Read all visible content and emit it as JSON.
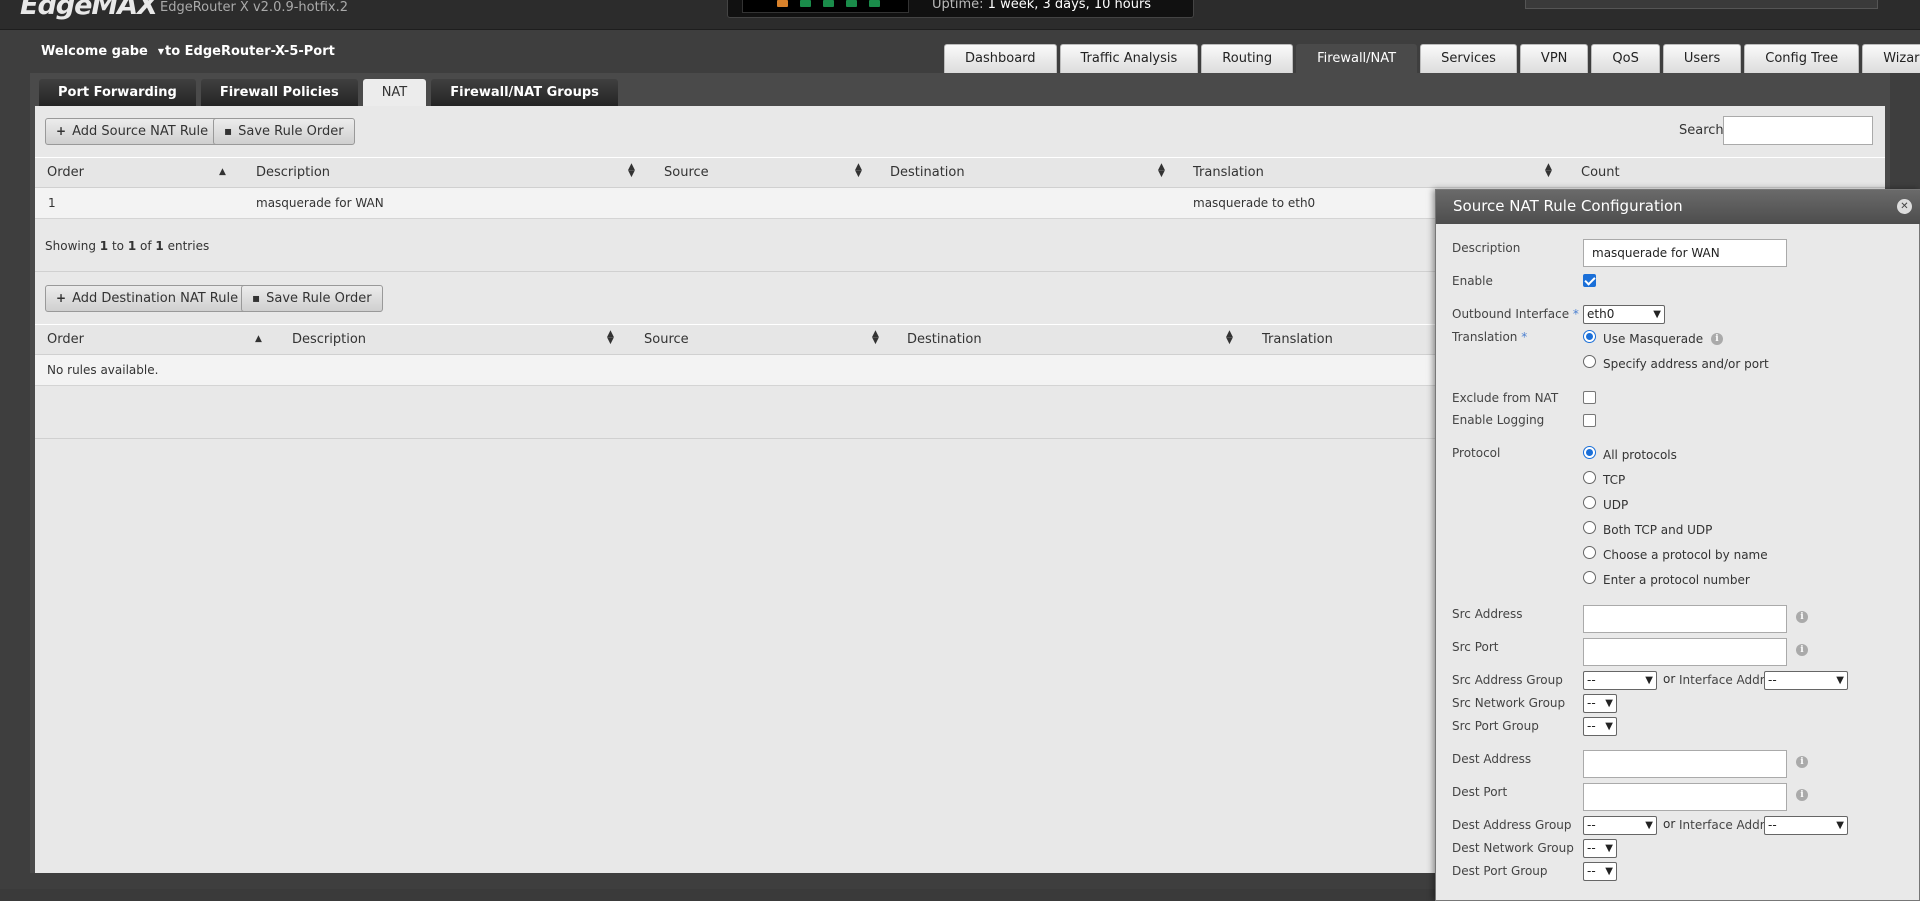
{
  "header": {
    "logo": "EdgeMAX",
    "version": "EdgeRouter X v2.0.9-hotfix.2",
    "uptime_label": "Uptime:",
    "uptime_value": "1 week, 3 days, 10 hours"
  },
  "user": {
    "welcome": "Welcome gabe",
    "device": "to EdgeRouter-X-5-Port"
  },
  "main_nav": {
    "items": [
      "Dashboard",
      "Traffic Analysis",
      "Routing",
      "Firewall/NAT",
      "Services",
      "VPN",
      "QoS",
      "Users",
      "Config Tree",
      "Wizards"
    ],
    "active": "Firewall/NAT"
  },
  "sub_tabs": {
    "items": [
      "Port Forwarding",
      "Firewall Policies",
      "NAT",
      "Firewall/NAT Groups"
    ],
    "active": "NAT"
  },
  "source_nat": {
    "add_button": "Add Source NAT Rule",
    "save_button": "Save Rule Order",
    "search_label": "Search",
    "columns": [
      "Order",
      "Description",
      "Source",
      "Destination",
      "Translation",
      "Count"
    ],
    "rows": [
      {
        "order": "1",
        "description": "masquerade for WAN",
        "source": "",
        "destination": "",
        "translation": "masquerade to eth0"
      }
    ],
    "showing_prefix": "Showing",
    "showing_from": "1",
    "showing_to_word": "to",
    "showing_to": "1",
    "showing_of_word": "of",
    "showing_total": "1",
    "showing_suffix": "entries"
  },
  "dest_nat": {
    "add_button": "Add Destination NAT Rule",
    "save_button": "Save Rule Order",
    "columns": [
      "Order",
      "Description",
      "Source",
      "Destination",
      "Translation"
    ],
    "empty_text": "No rules available."
  },
  "panel": {
    "title": "Source NAT Rule Configuration",
    "description_label": "Description",
    "description_value": "masquerade for WAN",
    "enable_label": "Enable",
    "enable_checked": true,
    "outbound_label": "Outbound Interface",
    "outbound_value": "eth0",
    "translation_label": "Translation",
    "translation_options": [
      "Use Masquerade",
      "Specify address and/or port"
    ],
    "translation_selected": "Use Masquerade",
    "exclude_label": "Exclude from NAT",
    "exclude_checked": false,
    "logging_label": "Enable Logging",
    "logging_checked": false,
    "protocol_label": "Protocol",
    "protocol_options": [
      "All protocols",
      "TCP",
      "UDP",
      "Both TCP and UDP",
      "Choose a protocol by name",
      "Enter a protocol number"
    ],
    "protocol_selected": "All protocols",
    "src_address_label": "Src Address",
    "src_port_label": "Src Port",
    "src_address_group_label": "Src Address Group",
    "src_address_group_value": "--",
    "or_text": "or",
    "interface_addr_label": "Interface Addr",
    "src_interface_addr_value": "--",
    "src_network_group_label": "Src Network Group",
    "src_network_group_value": "--",
    "src_port_group_label": "Src Port Group",
    "src_port_group_value": "--",
    "dest_address_label": "Dest Address",
    "dest_port_label": "Dest Port",
    "dest_address_group_label": "Dest Address Group",
    "dest_address_group_value": "--",
    "dest_interface_addr_value": "--",
    "dest_network_group_label": "Dest Network Group",
    "dest_network_group_value": "--",
    "dest_port_group_label": "Dest Port Group",
    "dest_port_group_value": "--"
  },
  "colors": {
    "accent_blue": "#1a6fd8",
    "required_star": "#4a7fd0",
    "port_led_green": "#1a8c4a",
    "port_led_orange": "#d9822b"
  }
}
